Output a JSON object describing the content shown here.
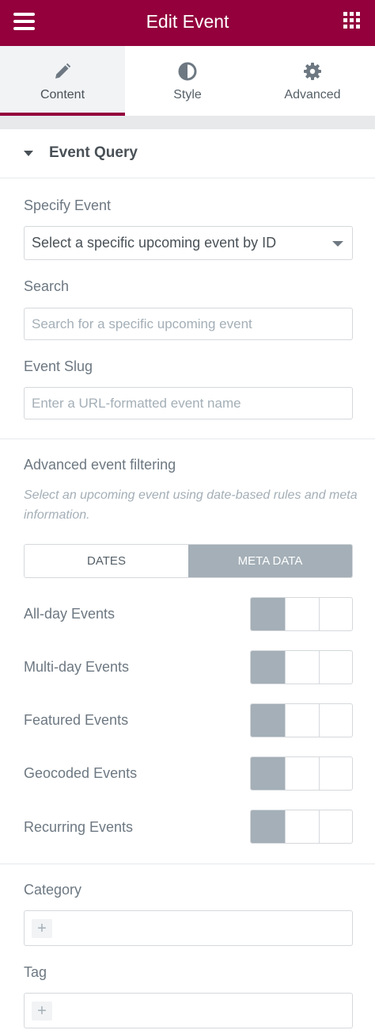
{
  "header": {
    "title": "Edit Event",
    "menu_icon": "hamburger-icon",
    "apps_icon": "grid-icon"
  },
  "tabs": [
    {
      "label": "Content",
      "icon": "pencil-icon",
      "active": true
    },
    {
      "label": "Style",
      "icon": "half-circle-icon",
      "active": false
    },
    {
      "label": "Advanced",
      "icon": "gear-icon",
      "active": false
    }
  ],
  "section": {
    "title": "Event Query"
  },
  "specify_event": {
    "label": "Specify Event",
    "value": "Select a specific upcoming event by ID"
  },
  "search": {
    "label": "Search",
    "placeholder": "Search for a specific upcoming event"
  },
  "slug": {
    "label": "Event Slug",
    "placeholder": "Enter a URL-formatted event name"
  },
  "advanced": {
    "label": "Advanced event filtering",
    "description": "Select an upcoming event using date-based rules and meta information.",
    "options": [
      "DATES",
      "META DATA"
    ],
    "selected": "META DATA"
  },
  "meta_filters": [
    {
      "label": "All-day Events",
      "selected_index": 0
    },
    {
      "label": "Multi-day Events",
      "selected_index": 0
    },
    {
      "label": "Featured Events",
      "selected_index": 0
    },
    {
      "label": "Geocoded Events",
      "selected_index": 0
    },
    {
      "label": "Recurring Events",
      "selected_index": 0
    }
  ],
  "category": {
    "label": "Category",
    "add_symbol": "+"
  },
  "tag": {
    "label": "Tag",
    "add_symbol": "+"
  },
  "colors": {
    "brand": "#93003c",
    "active_fill": "#a4afb7",
    "text": "#6d7882"
  }
}
